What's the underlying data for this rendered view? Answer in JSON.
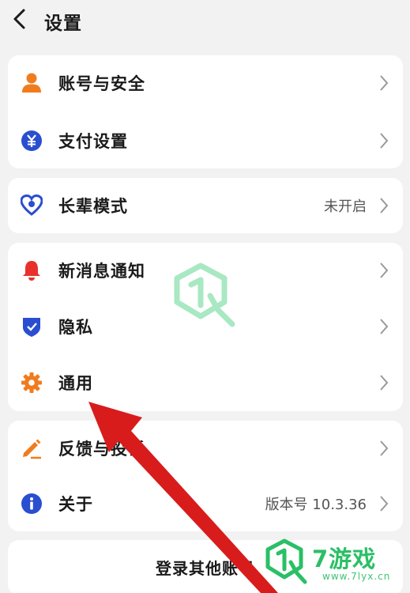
{
  "header": {
    "title": "设置"
  },
  "groups": [
    {
      "items": [
        {
          "label": "账号与安全",
          "icon": "person-icon",
          "color": "#f07c1e"
        },
        {
          "label": "支付设置",
          "icon": "yuan-icon",
          "color": "#2a4ed0"
        }
      ]
    },
    {
      "items": [
        {
          "label": "长辈模式",
          "value": "未开启",
          "icon": "heart-icon",
          "color": "#2a4ed0"
        }
      ]
    },
    {
      "items": [
        {
          "label": "新消息通知",
          "icon": "bell-icon",
          "color": "#e8312c"
        },
        {
          "label": "隐私",
          "icon": "shield-icon",
          "color": "#2a4ed0"
        },
        {
          "label": "通用",
          "icon": "gear-icon",
          "color": "#f07c1e"
        }
      ]
    },
    {
      "items": [
        {
          "label": "反馈与投诉",
          "icon": "pen-icon",
          "color": "#f07c1e"
        },
        {
          "label": "关于",
          "value": "版本号 10.3.36",
          "icon": "info-icon",
          "color": "#2a4ed0"
        }
      ]
    }
  ],
  "bottom": {
    "label": "登录其他账号"
  },
  "watermark": {
    "brand": "7游戏",
    "url": "www.7lyx.cn",
    "color": "#2bbf66"
  },
  "annotation": {
    "arrow_color": "#d81c1c"
  }
}
